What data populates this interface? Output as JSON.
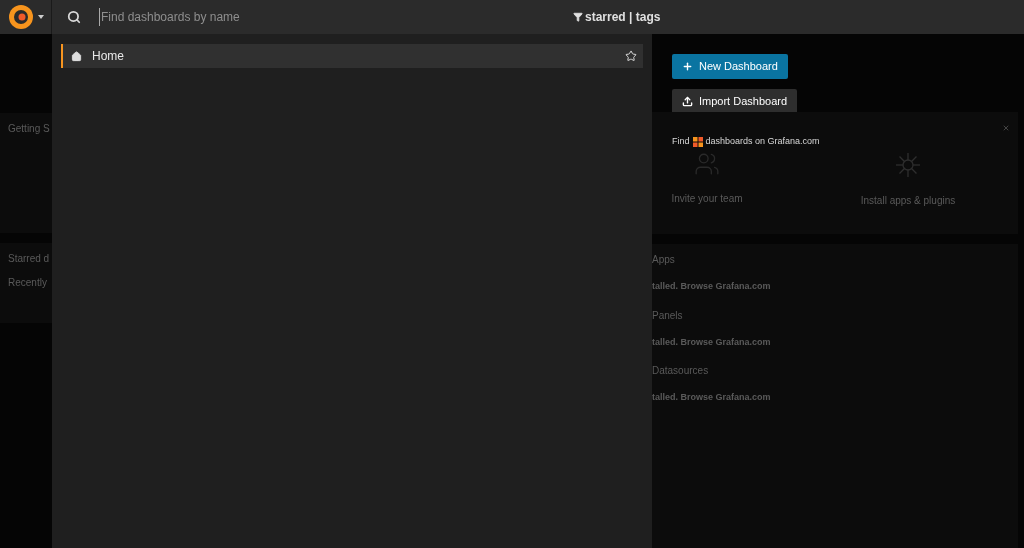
{
  "top_bar": {
    "search": {
      "placeholder": "Find dashboards by name"
    },
    "filter": "starred | tags"
  },
  "results": [
    {
      "title": "Home",
      "selected": true,
      "starred": false
    }
  ],
  "actions": [
    {
      "kind": "new",
      "label": "New Dashboard"
    },
    {
      "kind": "import",
      "label": "Import Dashboard"
    }
  ],
  "background": {
    "left_panels": [
      {
        "lines": [
          "Getting S"
        ]
      },
      {
        "lines": [
          "Starred d",
          "Recently"
        ]
      }
    ],
    "getting_started": {
      "find_before": "Find",
      "find_after": "dashboards on Grafana.com",
      "steps": [
        {
          "kind": "team",
          "label": "Invite your team"
        },
        {
          "kind": "plugins",
          "label": "Install apps & plugins"
        }
      ]
    },
    "plugin_sections": [
      {
        "title": "Apps",
        "text": "talled. Browse Grafana.com"
      },
      {
        "title": "Panels",
        "text": "talled. Browse Grafana.com"
      },
      {
        "title": "Datasources",
        "text": "talled. Browse Grafana.com"
      }
    ]
  }
}
